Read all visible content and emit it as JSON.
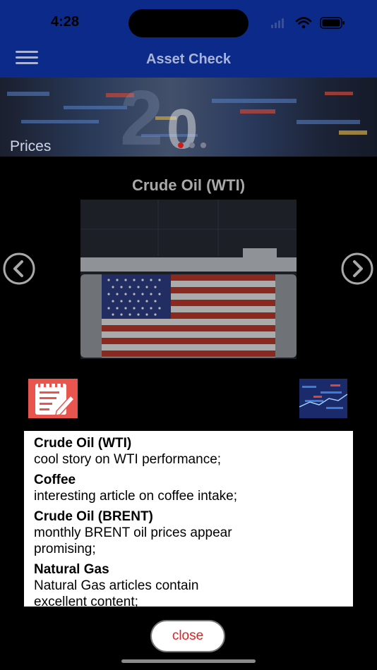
{
  "status_bar": {
    "time": "4:28"
  },
  "nav": {
    "title": "Asset Check",
    "menu_icon": "hamburger-icon"
  },
  "banner": {
    "label": "Prices",
    "page_count": 3,
    "active_page": 1
  },
  "asset": {
    "title": "Crude Oil (WTI)"
  },
  "icons": {
    "prev": "chevron-left-icon",
    "next": "chevron-right-icon",
    "notes": "notepad-pencil-icon",
    "market": "stock-ticker-icon"
  },
  "news": [
    {
      "title": "Crude Oil (WTI)",
      "desc": "cool story on WTI performance;"
    },
    {
      "title": "Coffee",
      "desc": "interesting article on coffee intake;"
    },
    {
      "title": "Crude Oil (BRENT)",
      "desc": "monthly BRENT oil prices appear promising;"
    },
    {
      "title": "Natural Gas",
      "desc": "Natural Gas articles contain excellent content;"
    }
  ],
  "close_label": "close",
  "colors": {
    "nav_bg": "#0b2a8a",
    "close_text": "#e32020",
    "active_dot": "#d21a1a"
  }
}
